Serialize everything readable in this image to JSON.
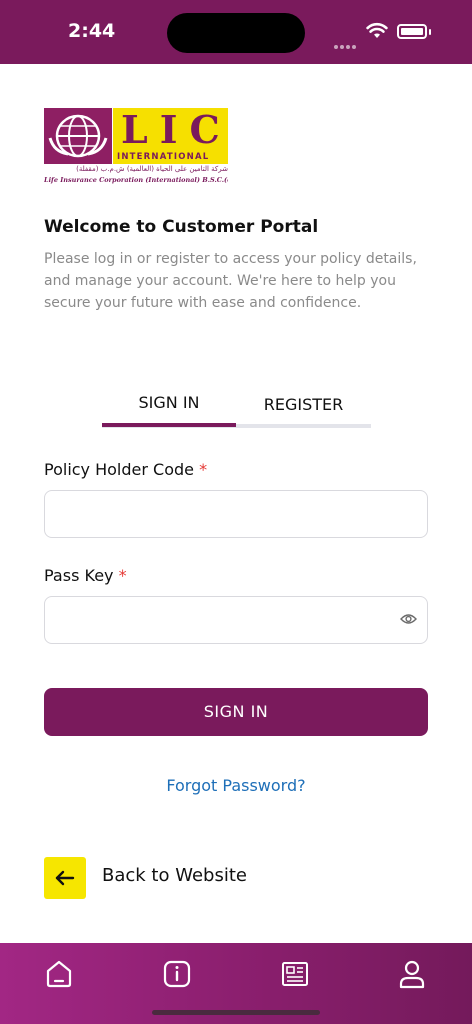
{
  "status_bar": {
    "time": "2:44"
  },
  "logo": {
    "brand": "LIC",
    "subtitle": "INTERNATIONAL",
    "arabic_name": "شركة التأمين على الحياة (العالمية) ش.م.ب (مقفلة)",
    "english_name": "Life Insurance Corporation (International) B.S.C.(c)"
  },
  "welcome": {
    "title": "Welcome to Customer Portal",
    "text": "Please log in or register to access your policy details, and manage your account. We're here to help you secure your future with ease and confidence."
  },
  "tabs": {
    "signin": "SIGN IN",
    "register": "REGISTER",
    "active": "signin"
  },
  "form": {
    "policy_label": "Policy Holder Code",
    "passkey_label": "Pass Key",
    "required_mark": "*",
    "policy_value": "",
    "passkey_value": ""
  },
  "actions": {
    "signin_button": "SIGN IN",
    "forgot_password": "Forgot Password?",
    "back_to_website": "Back to Website"
  },
  "bottom_nav": {
    "items": [
      "home-icon",
      "info-icon",
      "news-icon",
      "profile-icon"
    ]
  },
  "colors": {
    "primary": "#7a1a5c",
    "accent_yellow": "#f6e600",
    "link": "#1e6fb8",
    "required": "#e53935"
  }
}
